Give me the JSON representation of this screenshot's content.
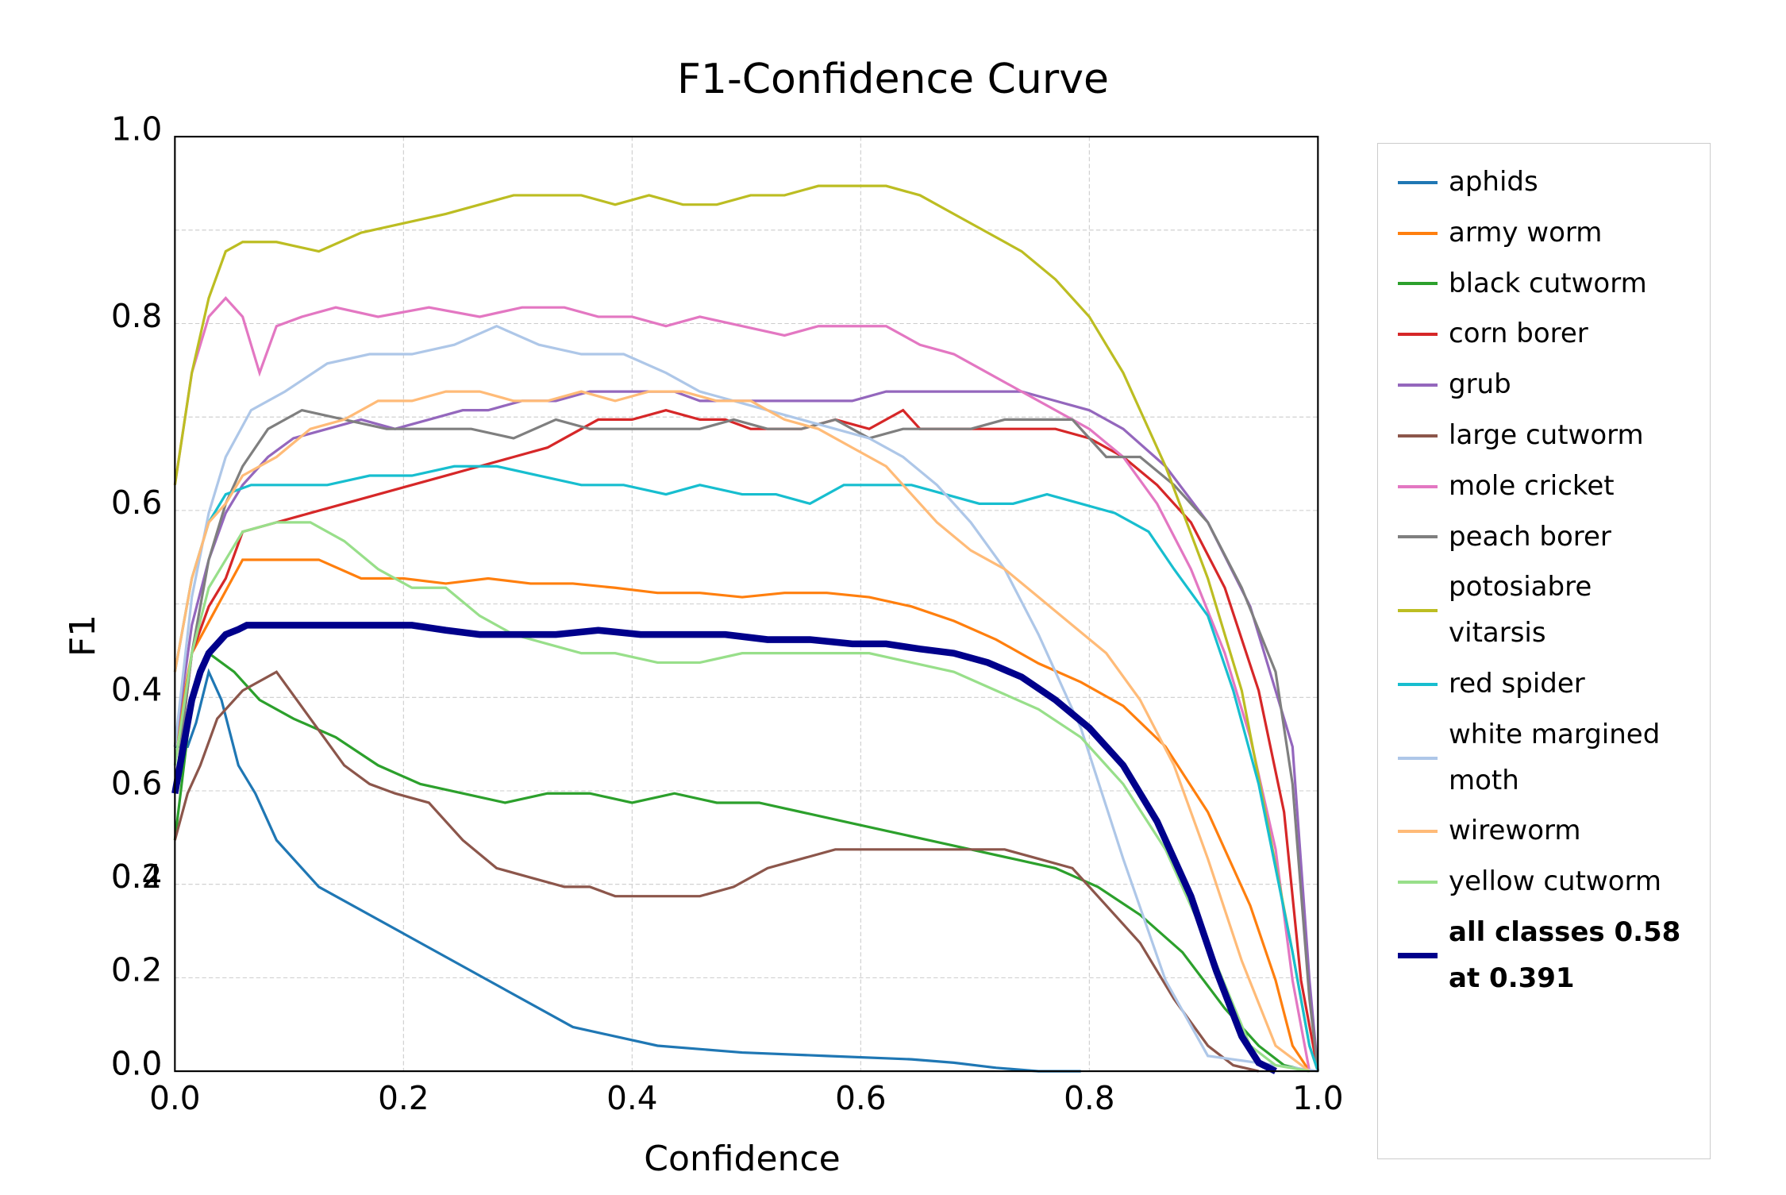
{
  "title": "F1-Confidence Curve",
  "x_label": "Confidence",
  "y_label": "F1",
  "legend": {
    "items": [
      {
        "label": "aphids",
        "color": "#1f77b4",
        "thick": false
      },
      {
        "label": "army worm",
        "color": "#ff7f0e",
        "thick": false
      },
      {
        "label": "black cutworm",
        "color": "#2ca02c",
        "thick": false
      },
      {
        "label": "corn borer",
        "color": "#d62728",
        "thick": false
      },
      {
        "label": "grub",
        "color": "#9467bd",
        "thick": false
      },
      {
        "label": "large cutworm",
        "color": "#8c564b",
        "thick": false
      },
      {
        "label": "mole cricket",
        "color": "#e377c2",
        "thick": false
      },
      {
        "label": "peach borer",
        "color": "#7f7f7f",
        "thick": false
      },
      {
        "label": "potosiabre vitarsis",
        "color": "#bcbd22",
        "thick": false
      },
      {
        "label": "red spider",
        "color": "#17becf",
        "thick": false
      },
      {
        "label": "white margined moth",
        "color": "#aec7e8",
        "thick": false
      },
      {
        "label": "wireworm",
        "color": "#ffbb78",
        "thick": false
      },
      {
        "label": "yellow cutworm",
        "color": "#98df8a",
        "thick": false
      },
      {
        "label": "all classes 0.58 at 0.391",
        "color": "#00008b",
        "thick": true
      }
    ]
  }
}
